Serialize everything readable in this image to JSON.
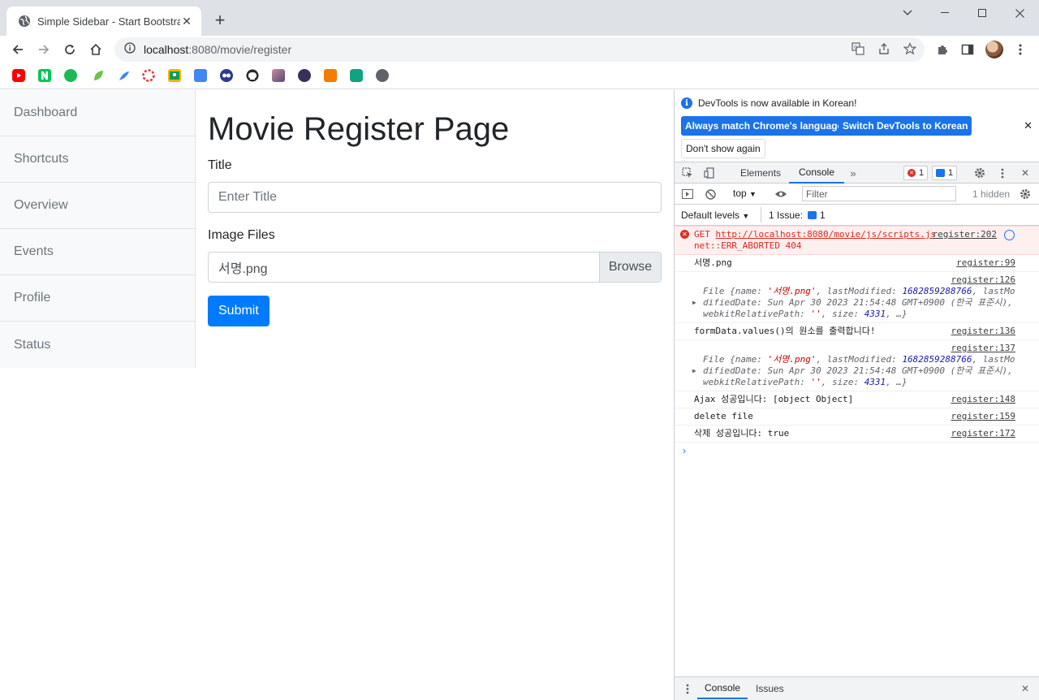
{
  "browser": {
    "tab_title": "Simple Sidebar - Start Bootstrap",
    "url_host": "localhost",
    "url_path": ":8080/movie/register"
  },
  "sidebar": {
    "items": [
      {
        "label": "Dashboard"
      },
      {
        "label": "Shortcuts"
      },
      {
        "label": "Overview"
      },
      {
        "label": "Events"
      },
      {
        "label": "Profile"
      },
      {
        "label": "Status"
      }
    ]
  },
  "form": {
    "heading": "Movie Register Page",
    "title_label": "Title",
    "title_placeholder": "Enter Title",
    "image_label": "Image Files",
    "file_name": "서명.png",
    "browse_label": "Browse",
    "submit_label": "Submit"
  },
  "devtools": {
    "notice_text": "DevTools is now available in Korean!",
    "btn_match": "Always match Chrome's language",
    "btn_switch": "Switch DevTools to Korean",
    "btn_dont_show": "Don't show again",
    "tabs": {
      "elements": "Elements",
      "console": "Console"
    },
    "error_count": "1",
    "message_count": "1",
    "context": "top",
    "filter_placeholder": "Filter",
    "hidden": "1 hidden",
    "levels": "Default levels",
    "issues_label": "1 Issue:",
    "issues_count": "1",
    "drawer_tabs": {
      "console": "Console",
      "issues": "Issues"
    }
  },
  "console": {
    "error": {
      "method": "GET",
      "url": "http://localhost:8080/movie/js/scripts.js",
      "status": "net::ERR_ABORTED 404",
      "src": "register:202"
    },
    "log1": {
      "text": "서명.png",
      "src": "register:99"
    },
    "obj1": {
      "src": "register:126",
      "line1_prefix": "File {name: ",
      "name_val": "'서명.png'",
      "mid": ", lastModified: ",
      "lm_val": "1682859288766",
      "line1_suffix": ", lastMo",
      "line2": "difiedDate: Sun Apr 30 2023 21:54:48 GMT+0900 (한국 표준시),",
      "line3_prefix": "webkitRelativePath: ",
      "wrp_val": "''",
      "size_label": ", size: ",
      "size_val": "4331",
      "line3_suffix": ", …}"
    },
    "log2": {
      "text": "formData.values()의 원소를 출력합니다!",
      "src": "register:136"
    },
    "obj2": {
      "src": "register:137"
    },
    "log3": {
      "text": "Ajax 성공입니다: [object Object]",
      "src": "register:148"
    },
    "log4": {
      "text": "delete file",
      "src": "register:159"
    },
    "log5": {
      "text": "삭제 성공입니다: true",
      "src": "register:172"
    }
  }
}
